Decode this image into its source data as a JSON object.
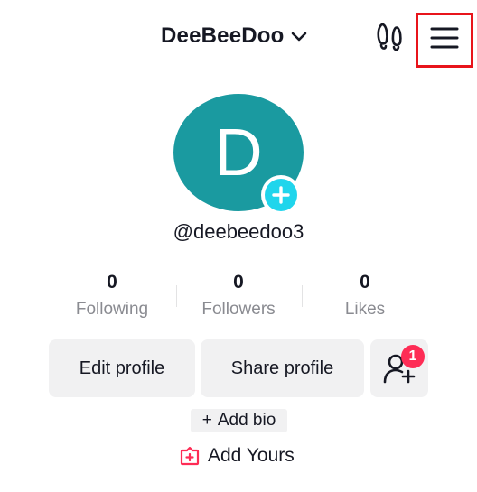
{
  "header": {
    "username": "DeeBeeDoo",
    "icons": {
      "switch": "chevron-down-icon",
      "footprints": "footprints-icon",
      "menu": "hamburger-menu-icon"
    },
    "highlight_color": "#e8141b"
  },
  "profile": {
    "avatar_letter": "D",
    "avatar_color": "#1a9aa0",
    "avatar_add_color": "#20d5ec",
    "handle": "@deebeedoo3"
  },
  "stats": [
    {
      "value": "0",
      "label": "Following"
    },
    {
      "value": "0",
      "label": "Followers"
    },
    {
      "value": "0",
      "label": "Likes"
    }
  ],
  "actions": {
    "edit_profile": "Edit profile",
    "share_profile": "Share profile",
    "add_friends_badge": "1"
  },
  "bio": {
    "add_bio": "Add bio",
    "add_bio_prefix": "+",
    "add_yours": "Add Yours",
    "add_yours_color": "#fe2c55"
  }
}
